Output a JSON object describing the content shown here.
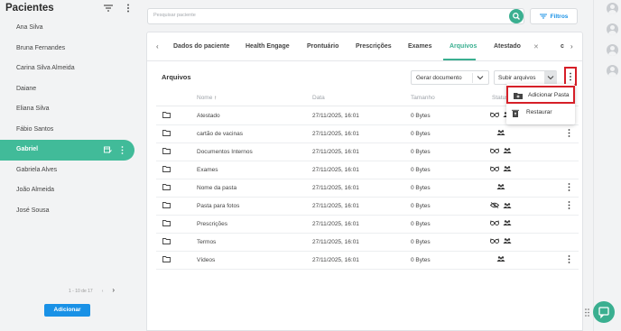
{
  "sidebar": {
    "title": "Pacientes",
    "patients": [
      "Ana Silva",
      "Bruna Fernandes",
      "Carina Silva Almeida",
      "Daiane",
      "Eliana Silva",
      "Fábio Santos",
      "Gabriel",
      "Gabriela Alves",
      "João Almeida",
      "José Sousa"
    ],
    "active_index": 6,
    "pager": "1 - 10 de 17",
    "add_label": "Adicionar"
  },
  "search": {
    "placeholder": "Pesquisar paciente"
  },
  "filters_label": "Filtros",
  "tabs": [
    "Dados do paciente",
    "Health Engage",
    "Prontuário",
    "Prescrições",
    "Exames",
    "Arquivos",
    "Atestado",
    "c"
  ],
  "active_tab": "Arquivos",
  "section_title": "Arquivos",
  "gen_doc_label": "Gerar documento",
  "upload_label": "Subir arquivos",
  "dropdown": {
    "add_folder": "Adicionar Pasta",
    "restore": "Restaurar"
  },
  "table": {
    "headers": {
      "name": "Nome",
      "date": "Data",
      "size": "Tamanho",
      "status": "Status"
    },
    "rows": [
      {
        "name": "Atestado",
        "date": "27/11/2025, 16:01",
        "size": "0 Bytes",
        "status": "glasses-people",
        "more": false
      },
      {
        "name": "cartão de vacinas",
        "date": "27/11/2025, 16:01",
        "size": "0 Bytes",
        "status": "people",
        "more": true
      },
      {
        "name": "Documentos Internos",
        "date": "27/11/2025, 16:01",
        "size": "0 Bytes",
        "status": "glasses-people",
        "more": false
      },
      {
        "name": "Exames",
        "date": "27/11/2025, 16:01",
        "size": "0 Bytes",
        "status": "glasses-people",
        "more": false
      },
      {
        "name": "Nome da pasta",
        "date": "27/11/2025, 16:01",
        "size": "0 Bytes",
        "status": "people",
        "more": true
      },
      {
        "name": "Pasta para fotos",
        "date": "27/11/2025, 16:01",
        "size": "0 Bytes",
        "status": "eye-off-people",
        "more": true
      },
      {
        "name": "Prescrições",
        "date": "27/11/2025, 16:01",
        "size": "0 Bytes",
        "status": "glasses-people",
        "more": false
      },
      {
        "name": "Termos",
        "date": "27/11/2025, 16:01",
        "size": "0 Bytes",
        "status": "glasses-people",
        "more": false
      },
      {
        "name": "Vídeos",
        "date": "27/11/2025, 16:01",
        "size": "0 Bytes",
        "status": "people",
        "more": true
      }
    ]
  },
  "colors": {
    "accent": "#3aaf90",
    "active_patient": "#41bb99",
    "primary": "#1991e6",
    "highlight": "#d61f28"
  }
}
